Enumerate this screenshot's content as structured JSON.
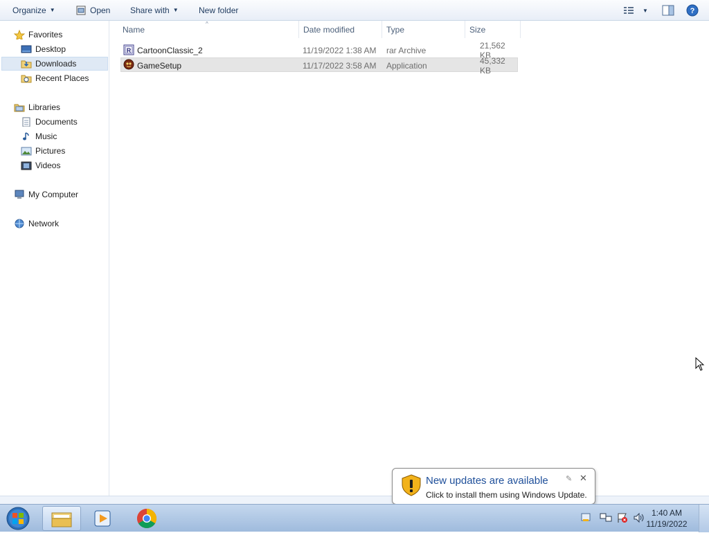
{
  "toolbar": {
    "organize": "Organize",
    "open": "Open",
    "share_with": "Share with",
    "new_folder": "New folder"
  },
  "nav": {
    "favorites": "Favorites",
    "desktop": "Desktop",
    "downloads": "Downloads",
    "recent_places": "Recent Places",
    "libraries": "Libraries",
    "documents": "Documents",
    "music": "Music",
    "pictures": "Pictures",
    "videos": "Videos",
    "my_computer": "My Computer",
    "network": "Network"
  },
  "columns": {
    "name": "Name",
    "date_modified": "Date modified",
    "type": "Type",
    "size": "Size"
  },
  "files": [
    {
      "name": "CartoonClassic_2",
      "date": "11/19/2022 1:38 AM",
      "type": "rar Archive",
      "size": "21,562 KB"
    },
    {
      "name": "GameSetup",
      "date": "11/17/2022 3:58 AM",
      "type": "Application",
      "size": "45,332 KB"
    }
  ],
  "notification": {
    "title": "New updates are available",
    "text": "Click to install them using Windows Update."
  },
  "clock": {
    "time": "1:40 AM",
    "date": "11/19/2022"
  },
  "colors": {
    "selection": "#dfe9f5",
    "accent": "#1e4f9a",
    "taskbar": "#b4cbe7"
  }
}
